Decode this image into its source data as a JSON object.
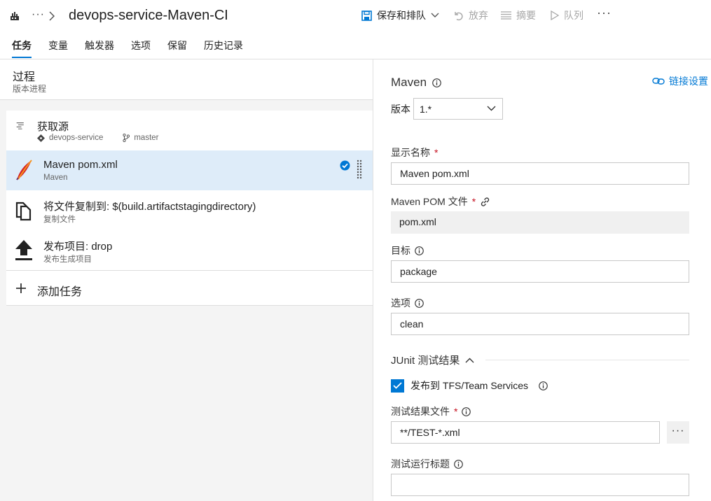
{
  "header": {
    "breadcrumb_more": "···",
    "title": "devops-service-Maven-CI",
    "toolbar": {
      "save_queue": "保存和排队",
      "discard": "放弃",
      "summary": "摘要",
      "queue": "队列",
      "more": "···"
    },
    "tabs": [
      "任务",
      "变量",
      "触发器",
      "选项",
      "保留",
      "历史记录"
    ],
    "active_tab": "任务"
  },
  "left": {
    "process": {
      "title": "过程",
      "subtitle": "版本进程"
    },
    "source": {
      "name": "获取源",
      "repo": "devops-service",
      "branch": "master"
    },
    "tasks": [
      {
        "name": "Maven pom.xml",
        "subtitle": "Maven",
        "selected": true
      },
      {
        "name": "将文件复制到: $(build.artifactstagingdirectory)",
        "subtitle": "复制文件"
      },
      {
        "name": "发布项目: drop",
        "subtitle": "发布生成项目"
      }
    ],
    "add_task": "添加任务"
  },
  "right": {
    "title": "Maven",
    "link_settings": "链接设置",
    "version_label": "版本",
    "version_value": "1.*",
    "display_name_label": "显示名称",
    "display_name_value": "Maven pom.xml",
    "pom_label": "Maven POM 文件",
    "pom_value": "pom.xml",
    "goals_label": "目标",
    "goals_value": "package",
    "options_label": "选项",
    "options_value": "clean",
    "junit_section": "JUnit 测试结果",
    "publish_label": "发布到 TFS/Team Services",
    "publish_checked": true,
    "test_files_label": "测试结果文件",
    "test_files_value": "**/TEST-*.xml",
    "more_button": "···",
    "test_run_title_label": "测试运行标题",
    "test_run_title_value": "",
    "required_mark": "*"
  },
  "colors": {
    "accent": "#0078d4",
    "selected_row": "#deecf9",
    "required": "#c50f1f"
  }
}
